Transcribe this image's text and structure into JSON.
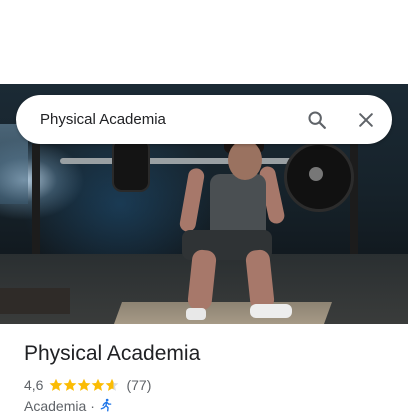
{
  "search": {
    "query": "Physical Academia",
    "search_icon": "search-icon",
    "close_icon": "close-icon"
  },
  "hero": {
    "image": "gym-squat-photo"
  },
  "place": {
    "title": "Physical Academia",
    "rating": "4,6",
    "rating_value": 4.6,
    "star_color": "#fbbc04",
    "reviews": "(77)",
    "category": "Academia",
    "separator": "·",
    "category_icon": "running-person-icon",
    "accent": "#1a73e8"
  }
}
